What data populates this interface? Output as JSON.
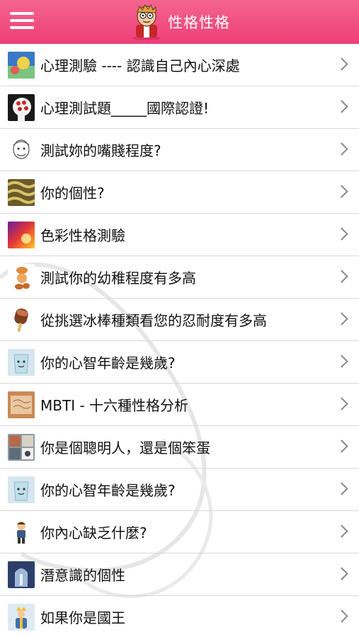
{
  "header": {
    "title": "性格性格"
  },
  "items": [
    {
      "label": "心理測驗 ---- 認識自己內心深處",
      "icon": "abstract-blue-thumb"
    },
    {
      "label": "心理測試題_____國際認證!",
      "icon": "head-diagram-thumb"
    },
    {
      "label": "測試妳的嘴賤程度?",
      "icon": "sketch-face-thumb"
    },
    {
      "label": "你的個性?",
      "icon": "pattern-thumb"
    },
    {
      "label": "色彩性格測驗",
      "icon": "color-burst-thumb"
    },
    {
      "label": "測試你的幼稚程度有多高",
      "icon": "cartoon-figure-thumb"
    },
    {
      "label": "從挑選冰棒種類看您的忍耐度有多高",
      "icon": "popsicle-thumb"
    },
    {
      "label": "你的心智年齡是幾歲?",
      "icon": "cup-face-thumb"
    },
    {
      "label": "MBTI - 十六種性格分析",
      "icon": "paper-thumb"
    },
    {
      "label": "你是個聰明人，還是個笨蛋",
      "icon": "collage-thumb"
    },
    {
      "label": "你的心智年齡是幾歲?",
      "icon": "cup-face-thumb"
    },
    {
      "label": "你內心缺乏什麼?",
      "icon": "boy-figure-thumb"
    },
    {
      "label": "潛意識的個性",
      "icon": "arch-window-thumb"
    },
    {
      "label": "如果你是國王",
      "icon": "king-thumb"
    }
  ],
  "colors": {
    "header": "#ee4a7f",
    "divider": "#d9d9d9",
    "chevron": "#8a8a8a"
  }
}
